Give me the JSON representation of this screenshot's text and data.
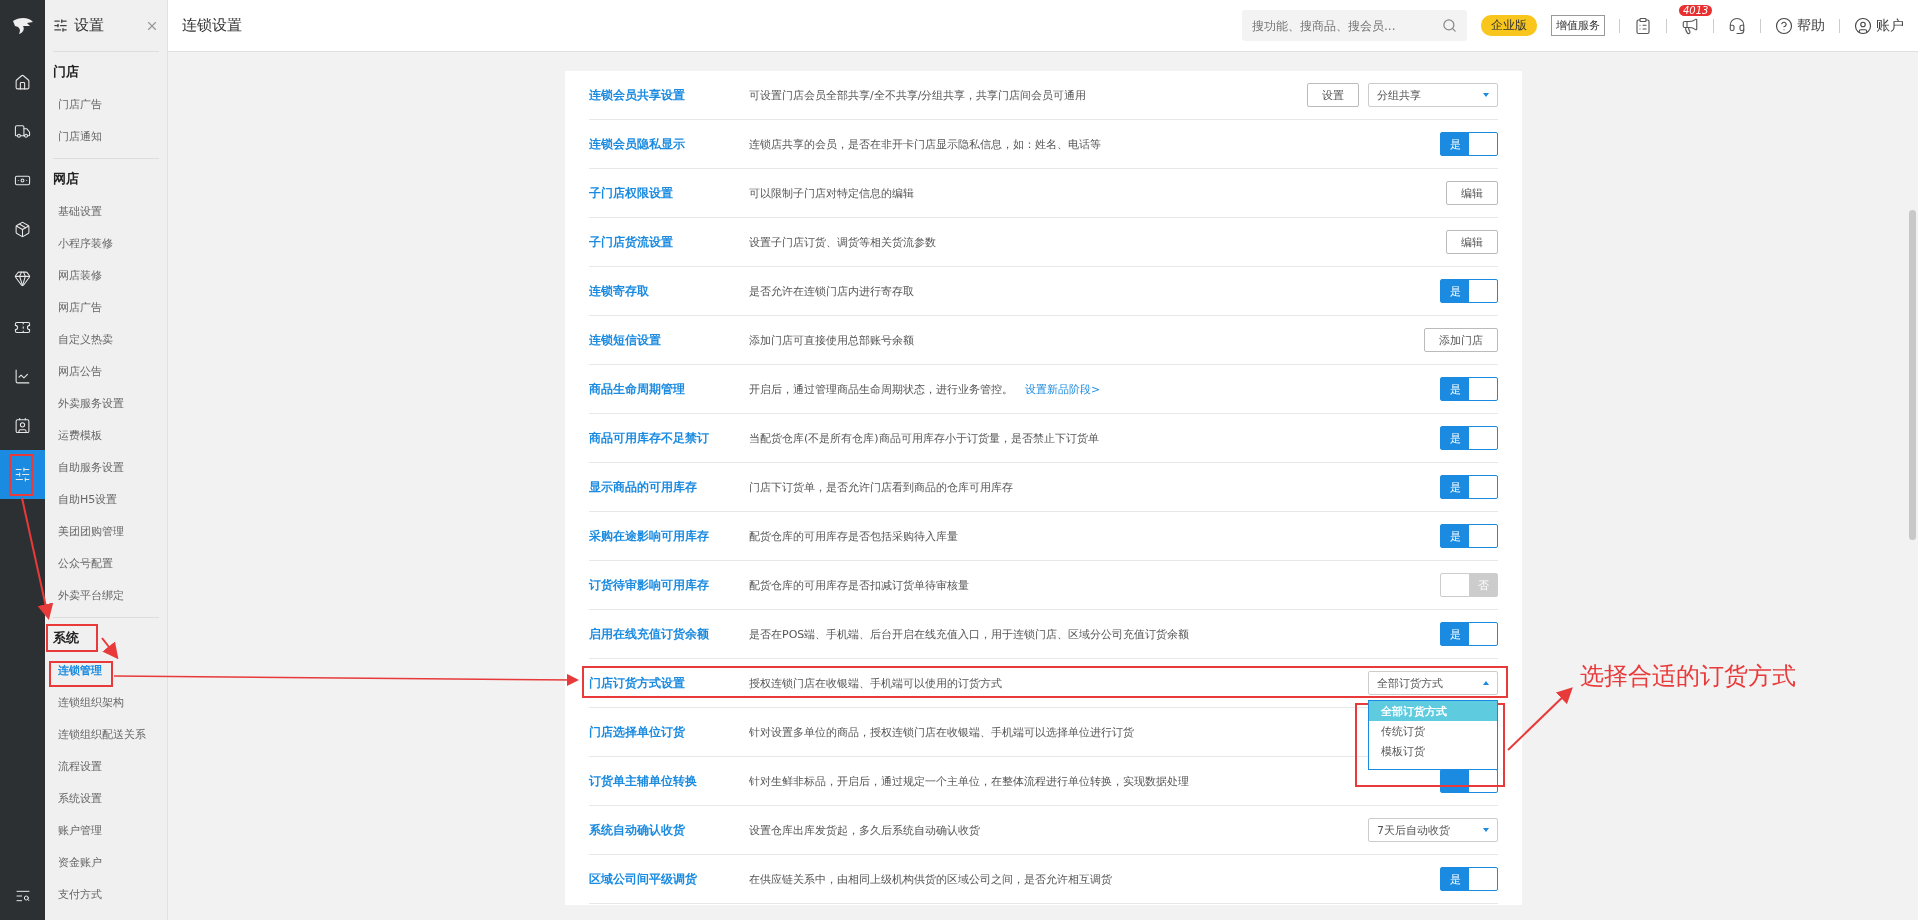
{
  "rail": [
    {
      "kind": "logo"
    },
    {
      "kind": "home",
      "selected": false
    },
    {
      "kind": "truck",
      "selected": false
    },
    {
      "kind": "money",
      "selected": false
    },
    {
      "kind": "box",
      "selected": false
    },
    {
      "kind": "diamond",
      "selected": false
    },
    {
      "kind": "ticket",
      "selected": false
    },
    {
      "kind": "chart",
      "selected": false
    },
    {
      "kind": "card",
      "selected": false
    },
    {
      "kind": "sliders",
      "selected": true
    }
  ],
  "rail_bottom": {
    "kind": "list"
  },
  "sidebar": {
    "title": "设置",
    "sections": [
      {
        "heading": "门店",
        "items": [
          {
            "label": "门店广告",
            "selected": false
          },
          {
            "label": "门店通知",
            "selected": false
          }
        ]
      },
      {
        "heading": "网店",
        "items": [
          {
            "label": "基础设置",
            "selected": false
          },
          {
            "label": "小程序装修",
            "selected": false
          },
          {
            "label": "网店装修",
            "selected": false
          },
          {
            "label": "网店广告",
            "selected": false
          },
          {
            "label": "自定义热卖",
            "selected": false
          },
          {
            "label": "网店公告",
            "selected": false
          },
          {
            "label": "外卖服务设置",
            "selected": false
          },
          {
            "label": "运费模板",
            "selected": false
          },
          {
            "label": "自助服务设置",
            "selected": false
          },
          {
            "label": "自助H5设置",
            "selected": false
          },
          {
            "label": "美团团购管理",
            "selected": false
          },
          {
            "label": "公众号配置",
            "selected": false
          },
          {
            "label": "外卖平台绑定",
            "selected": false
          }
        ]
      },
      {
        "heading": "系统",
        "items": [
          {
            "label": "连锁管理",
            "selected": true
          },
          {
            "label": "连锁组织架构",
            "selected": false
          },
          {
            "label": "连锁组织配送关系",
            "selected": false
          },
          {
            "label": "流程设置",
            "selected": false
          },
          {
            "label": "系统设置",
            "selected": false
          },
          {
            "label": "账户管理",
            "selected": false
          },
          {
            "label": "资金账户",
            "selected": false
          },
          {
            "label": "支付方式",
            "selected": false
          }
        ]
      }
    ]
  },
  "topbar": {
    "title": "连锁设置",
    "search": {
      "placeholder": "搜功能、搜商品、搜会员..."
    },
    "edition": "企业版",
    "service": "增值服务",
    "notice_count": "4013",
    "help": "帮助",
    "account": "账户"
  },
  "rows": [
    {
      "title": "连锁会员共享设置",
      "desc": "可设置门店会员全部共享/全不共享/分组共享，共享门店间会员可通用",
      "controls": [
        {
          "kind": "button",
          "label": "设置"
        },
        {
          "kind": "select",
          "value": "分组共享",
          "expanded": false
        }
      ]
    },
    {
      "title": "连锁会员隐私显示",
      "desc": "连锁店共享的会员，是否在非开卡门店显示隐私信息，如：姓名、电话等",
      "controls": [
        {
          "kind": "toggle",
          "on": true,
          "label": "是"
        }
      ]
    },
    {
      "title": "子门店权限设置",
      "desc": "可以限制子门店对特定信息的编辑",
      "controls": [
        {
          "kind": "button",
          "label": "编辑"
        }
      ]
    },
    {
      "title": "子门店货流设置",
      "desc": "设置子门店订货、调货等相关货流参数",
      "controls": [
        {
          "kind": "button",
          "label": "编辑"
        }
      ]
    },
    {
      "title": "连锁寄存取",
      "desc": "是否允许在连锁门店内进行寄存取",
      "controls": [
        {
          "kind": "toggle",
          "on": true,
          "label": "是"
        }
      ]
    },
    {
      "title": "连锁短信设置",
      "desc": "添加门店可直接使用总部账号余额",
      "controls": [
        {
          "kind": "button",
          "label": "添加门店"
        }
      ]
    },
    {
      "title": "商品生命周期管理",
      "desc": "开启后，通过管理商品生命周期状态，进行业务管控。",
      "link": "设置新品阶段>",
      "controls": [
        {
          "kind": "toggle",
          "on": true,
          "label": "是"
        }
      ]
    },
    {
      "title": "商品可用库存不足禁订",
      "desc": "当配货仓库(不是所有仓库)商品可用库存小于订货量，是否禁止下订货单",
      "controls": [
        {
          "kind": "toggle",
          "on": true,
          "label": "是"
        }
      ]
    },
    {
      "title": "显示商品的可用库存",
      "desc": "门店下订货单，是否允许门店看到商品的仓库可用库存",
      "controls": [
        {
          "kind": "toggle",
          "on": true,
          "label": "是"
        }
      ]
    },
    {
      "title": "采购在途影响可用库存",
      "desc": "配货仓库的可用库存是否包括采购待入库量",
      "controls": [
        {
          "kind": "toggle",
          "on": true,
          "label": "是"
        }
      ]
    },
    {
      "title": "订货待审影响可用库存",
      "desc": "配货仓库的可用库存是否扣减订货单待审核量",
      "controls": [
        {
          "kind": "toggle",
          "on": false,
          "label": "否"
        }
      ]
    },
    {
      "title": "启用在线充值订货余额",
      "desc": "是否在POS端、手机端、后台开启在线充值入口，用于连锁门店、区域分公司充值订货余额",
      "controls": [
        {
          "kind": "toggle",
          "on": true,
          "label": "是"
        }
      ]
    },
    {
      "title": "门店订货方式设置",
      "desc": "授权连锁门店在收银端、手机端可以使用的订货方式",
      "controls": [
        {
          "kind": "select",
          "value": "全部订货方式",
          "expanded": true,
          "options": [
            {
              "label": "全部订货方式",
              "selected": true
            },
            {
              "label": "传统订货",
              "selected": false
            },
            {
              "label": "模板订货",
              "selected": false
            }
          ]
        }
      ]
    },
    {
      "title": "门店选择单位订货",
      "desc": "针对设置多单位的商品，授权连锁门店在收银端、手机端可以选择单位进行订货",
      "controls": []
    },
    {
      "title": "订货单主辅单位转换",
      "desc": "针对生鲜非标品，开启后，通过规定一个主单位，在整体流程进行单位转换，实现数据处理",
      "controls": [
        {
          "kind": "toggle",
          "on": true
        }
      ]
    },
    {
      "title": "系统自动确认收货",
      "desc": "设置仓库出库发货起，多久后系统自动确认收货",
      "controls": [
        {
          "kind": "select",
          "value": "7天后自动收货",
          "expanded": false
        }
      ]
    },
    {
      "title": "区域公司间平级调货",
      "desc": "在供应链关系中，由相同上级机构供货的区域公司之间，是否允许相互调货",
      "controls": [
        {
          "kind": "toggle",
          "on": true,
          "label": "是"
        }
      ]
    }
  ],
  "annotation": {
    "callout": "选择合适的订货方式"
  }
}
